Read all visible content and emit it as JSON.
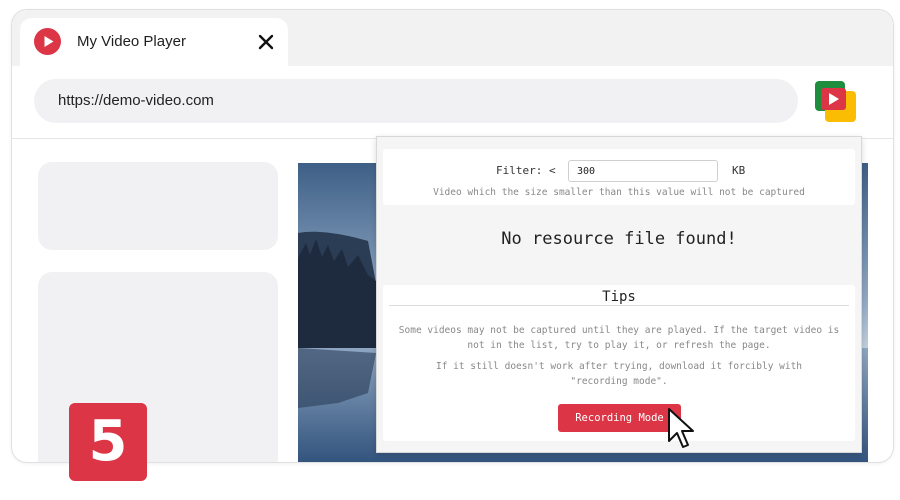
{
  "browser": {
    "tab": {
      "title": "My Video Player",
      "icon": "play-icon"
    },
    "url": "https://demo-video.com",
    "extension_icon": "video-downloader-icon"
  },
  "popup": {
    "filter": {
      "label": "Filter: <",
      "value": "300",
      "unit": "KB",
      "hint": "Video which the size smaller than this value will not be captured"
    },
    "empty_message": "No resource file found!",
    "tips": {
      "title": "Tips",
      "line1": "Some videos may not be captured until they are played. If the target video is not in the list, try to play it, or refresh the page.",
      "line2": "If it still doesn't work after trying, download it forcibly with \"recording mode\".",
      "button": "Recording Mode"
    }
  },
  "step_badge": "5",
  "colors": {
    "accent": "#dc3545",
    "tabbar": "#f2f2f3",
    "skeleton": "#f1f1f3",
    "ext_green": "#1e8e3e",
    "ext_yellow": "#fbbc04"
  }
}
